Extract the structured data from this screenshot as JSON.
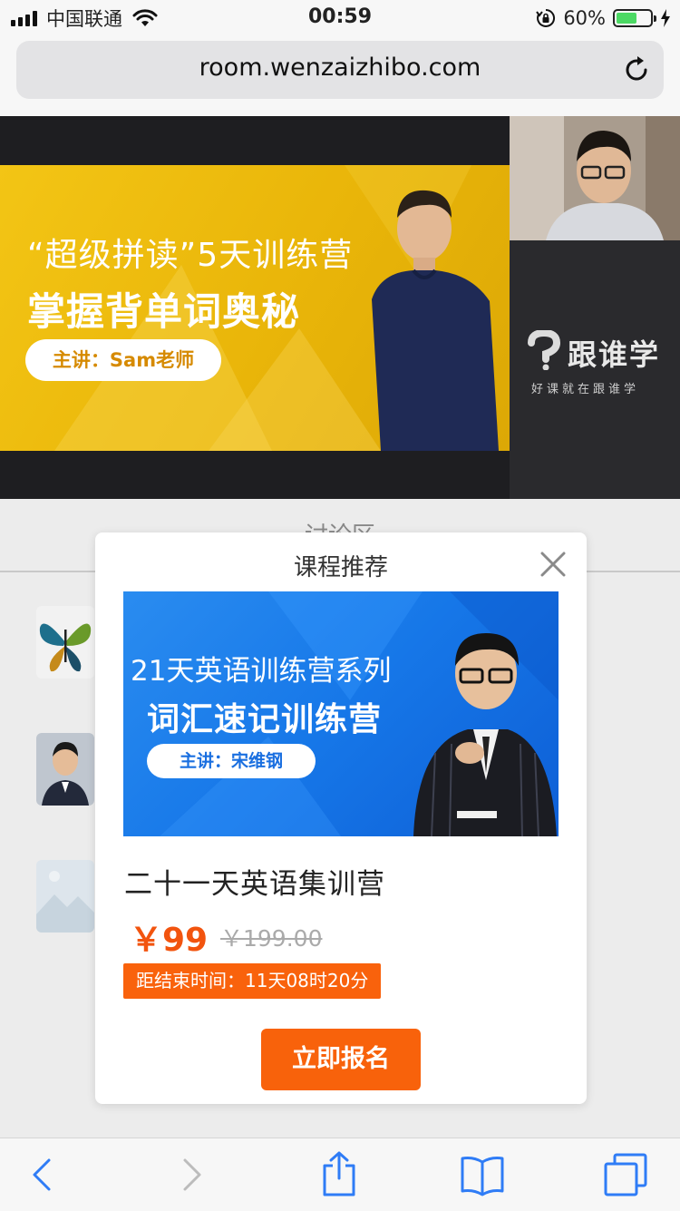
{
  "status_bar": {
    "carrier": "中国联通",
    "time": "00:59",
    "battery_percent": "60%",
    "battery_level": 0.6
  },
  "browser": {
    "url": "room.wenzaizhibo.com"
  },
  "live_banner": {
    "line1": "“超级拼读”5天训练营",
    "line2": "掌握背单词奥秘",
    "teacher": "主讲：Sam老师"
  },
  "brand": {
    "name": "跟谁学",
    "slogan": "好课就在跟谁学"
  },
  "discussion": {
    "tab_label": "讨论区"
  },
  "modal": {
    "title": "课程推荐",
    "banner_line1": "21天英语训练营系列",
    "banner_line2": "词汇速记训练营",
    "banner_teacher": "主讲：宋维钢",
    "course_name": "二十一天英语集训营",
    "price": "￥99",
    "original_price": "￥199.00",
    "countdown": "距结束时间：11天08时20分",
    "signup_label": "立即报名"
  },
  "colors": {
    "accent_orange": "#f8620b",
    "price_red": "#f2540f",
    "banner_yellow": "#f3c515",
    "banner_blue": "#1677e8",
    "ios_blue": "#2f7cf6"
  },
  "icons": [
    "signal-icon",
    "wifi-icon",
    "orientation-lock-icon",
    "battery-icon",
    "charging-icon",
    "reload-icon",
    "close-icon",
    "back-icon",
    "forward-icon",
    "share-icon",
    "bookmarks-icon",
    "tabs-icon"
  ]
}
